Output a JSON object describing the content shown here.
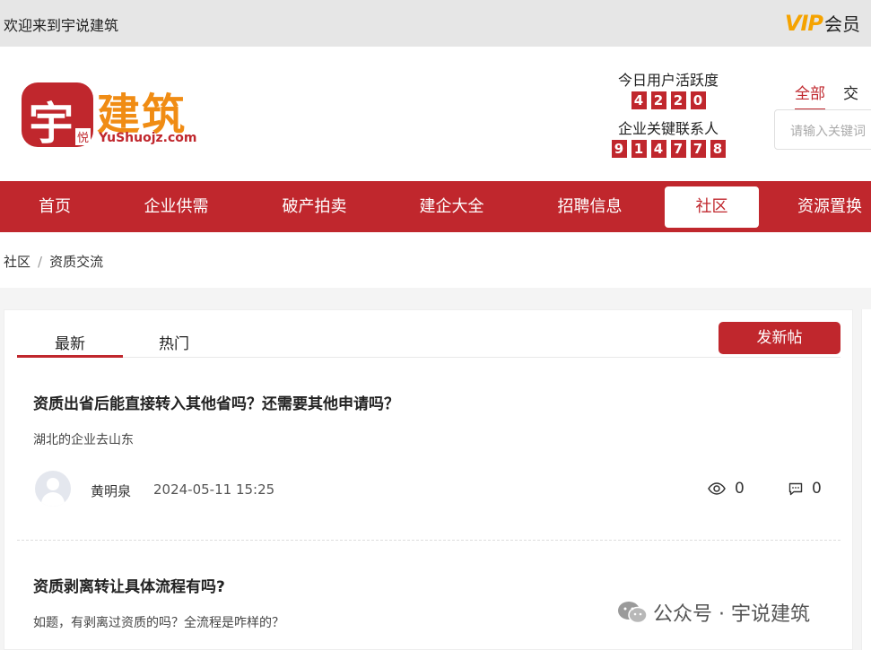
{
  "topbar": {
    "welcome": "欢迎来到宇说建筑",
    "vip_text": "VIP",
    "member_text": "会员"
  },
  "logo": {
    "badge_char": "宇",
    "badge_sub": "悦",
    "name": "建筑",
    "domain": "YuShuojz.com"
  },
  "stats": {
    "active_label": "今日用户活跃度",
    "active_digits": [
      "4",
      "2",
      "2",
      "0"
    ],
    "contacts_label": "企业关键联系人",
    "contacts_digits": [
      "9",
      "1",
      "4",
      "7",
      "7",
      "8"
    ]
  },
  "search": {
    "tabs": [
      "全部",
      "交"
    ],
    "placeholder": "请输入关键词"
  },
  "nav": {
    "items": [
      "首页",
      "企业供需",
      "破产拍卖",
      "建企大全",
      "招聘信息",
      "社区",
      "资源置换"
    ],
    "active": "社区"
  },
  "breadcrumb": {
    "items": [
      "社区",
      "资质交流"
    ],
    "separator": "/"
  },
  "feed": {
    "tabs": [
      "最新",
      "热门"
    ],
    "new_post_label": "发新帖",
    "posts": [
      {
        "title": "资质出省后能直接转入其他省吗？还需要其他申请吗？",
        "desc": "湖北的企业去山东",
        "author": "黄明泉",
        "time": "2024-05-11 15:25",
        "views": "0",
        "comments": "0"
      },
      {
        "title": "资质剥离转让具体流程有吗?",
        "desc": "如题，有剥离过资质的吗？全流程是咋样的？"
      }
    ]
  },
  "watermark": {
    "text": "公众号 · 宇说建筑"
  },
  "colors": {
    "brand_red": "#c0272d",
    "logo_orange": "#f08c14",
    "vip_gold": "#f5a300"
  }
}
